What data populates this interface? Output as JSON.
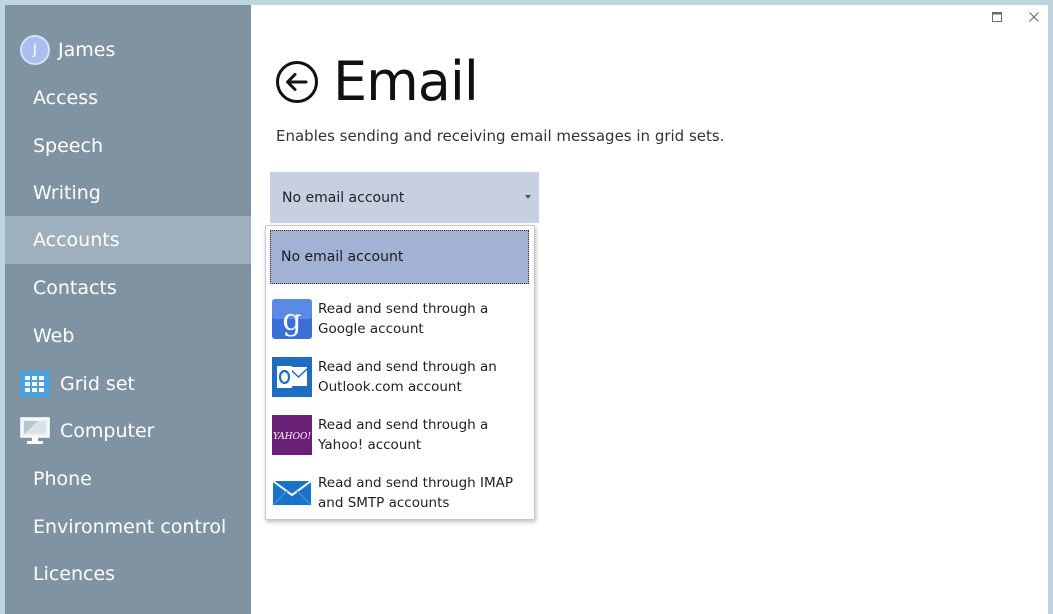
{
  "user": {
    "name": "James",
    "initial": "J"
  },
  "sidebar": {
    "items": [
      {
        "label": "Access"
      },
      {
        "label": "Speech"
      },
      {
        "label": "Writing"
      },
      {
        "label": "Accounts"
      },
      {
        "label": "Contacts"
      },
      {
        "label": "Web"
      },
      {
        "label": "Grid set",
        "icon": "grid-set-icon"
      },
      {
        "label": "Computer",
        "icon": "monitor-icon"
      },
      {
        "label": "Phone"
      },
      {
        "label": "Environment control"
      },
      {
        "label": "Licences"
      }
    ]
  },
  "page": {
    "title": "Email",
    "description": "Enables sending and receiving email messages in grid sets."
  },
  "email_select": {
    "selected": "No email account",
    "options": [
      {
        "label": "No email account"
      },
      {
        "label": "Read and send through a Google account",
        "icon": "google-icon"
      },
      {
        "label": "Read and send through an Outlook.com account",
        "icon": "outlook-icon"
      },
      {
        "label": "Read and send through a Yahoo! account",
        "icon": "yahoo-icon",
        "icon_text": "YAHOO!"
      },
      {
        "label": "Read and send through IMAP and SMTP accounts",
        "icon": "envelope-icon"
      }
    ]
  },
  "colors": {
    "sidebar_bg": "#7f93a3",
    "sidebar_selected": "#9eafbd",
    "select_bg": "#c7d0e0",
    "option_selected": "#a2b2d4",
    "google_blue": "#3b6fd8",
    "outlook_blue": "#1f6dc1",
    "yahoo_purple": "#6b2078",
    "envelope_blue": "#1a73c8"
  }
}
